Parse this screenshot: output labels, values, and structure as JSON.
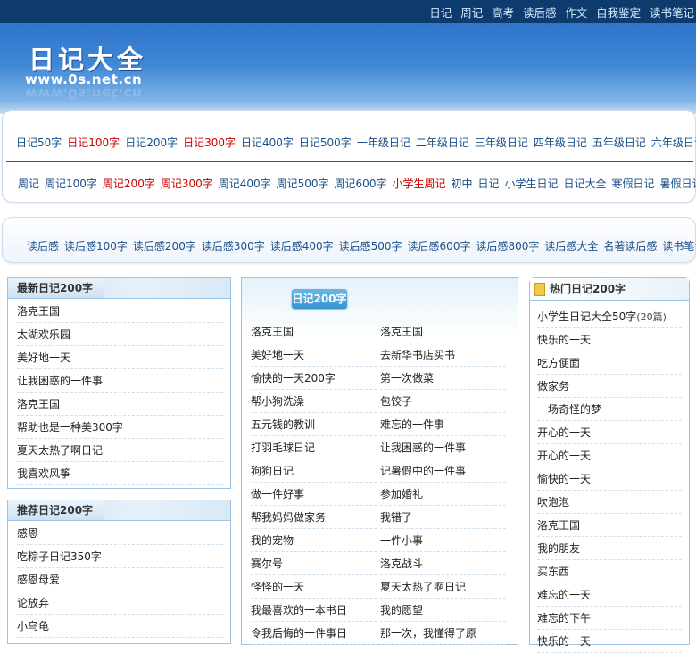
{
  "top_nav": [
    "日记",
    "周记",
    "高考",
    "读后感",
    "作文",
    "自我鉴定",
    "读书笔记"
  ],
  "logo": {
    "title": "日记大全",
    "url": "www.0s.net.cn"
  },
  "nav_row1": [
    {
      "label": "日记50字",
      "color": "blue"
    },
    {
      "label": "日记100字",
      "color": "red"
    },
    {
      "label": "日记200字",
      "color": "blue"
    },
    {
      "label": "日记300字",
      "color": "red"
    },
    {
      "label": "日记400字",
      "color": "blue"
    },
    {
      "label": "日记500字",
      "color": "blue"
    },
    {
      "label": "一年级日记",
      "color": "blue"
    },
    {
      "label": "二年级日记",
      "color": "blue"
    },
    {
      "label": "三年级日记",
      "color": "blue"
    },
    {
      "label": "四年级日记",
      "color": "blue"
    },
    {
      "label": "五年级日记",
      "color": "blue"
    },
    {
      "label": "六年级日记",
      "color": "blue"
    }
  ],
  "nav_row2": [
    {
      "label": "周记",
      "color": "blue"
    },
    {
      "label": "周记100字",
      "color": "blue"
    },
    {
      "label": "周记200字",
      "color": "red"
    },
    {
      "label": "周记300字",
      "color": "red"
    },
    {
      "label": "周记400字",
      "color": "blue"
    },
    {
      "label": "周记500字",
      "color": "blue"
    },
    {
      "label": "周记600字",
      "color": "blue"
    },
    {
      "label": "小学生周记",
      "color": "red"
    },
    {
      "label": "初中",
      "color": "blue"
    },
    {
      "label": "日记",
      "color": "blue"
    },
    {
      "label": "小学生日记",
      "color": "blue"
    },
    {
      "label": "日记大全",
      "color": "blue"
    },
    {
      "label": "寒假日记",
      "color": "blue"
    },
    {
      "label": "暑假日记",
      "color": "blue"
    }
  ],
  "nav_row3": [
    {
      "label": "读后感",
      "color": "blue"
    },
    {
      "label": "读后感100字",
      "color": "blue"
    },
    {
      "label": "读后感200字",
      "color": "blue"
    },
    {
      "label": "读后感300字",
      "color": "blue"
    },
    {
      "label": "读后感400字",
      "color": "blue"
    },
    {
      "label": "读后感500字",
      "color": "blue"
    },
    {
      "label": "读后感600字",
      "color": "blue"
    },
    {
      "label": "读后感800字",
      "color": "blue"
    },
    {
      "label": "读后感大全",
      "color": "blue"
    },
    {
      "label": "名著读后感",
      "color": "blue"
    },
    {
      "label": "读书笔记",
      "color": "blue"
    }
  ],
  "latest_box": {
    "title": "最新日记200字",
    "items": [
      "洛克王国",
      "太湖欢乐园",
      "美好地一天",
      "让我困惑的一件事",
      "洛克王国",
      "帮助也是一种美300字",
      "夏天太热了啊日记",
      "我喜欢风筝"
    ]
  },
  "recommend_box": {
    "title": "推荐日记200字",
    "items": [
      "感恩",
      "吃粽子日记350字",
      "感恩母爱",
      "论放弃",
      "小乌龟"
    ]
  },
  "middle_box": {
    "badge": "日记200字",
    "col1": [
      "洛克王国",
      "美好地一天",
      "愉快的一天200字",
      "帮小狗洗澡",
      "五元钱的教训",
      "打羽毛球日记",
      "狗狗日记",
      "做一件好事",
      "帮我妈妈做家务",
      "我的宠物",
      "赛尔号",
      "怪怪的一天",
      "我最喜欢的一本书日",
      "令我后悔的一件事日"
    ],
    "col2": [
      "洛克王国",
      "去新华书店买书",
      "第一次做菜",
      "包饺子",
      "难忘的一件事",
      "让我困惑的一件事",
      "记暑假中的一件事",
      "参加婚礼",
      "我错了",
      "一件小事",
      "洛克战斗",
      "夏天太热了啊日记",
      "我的愿望",
      "那一次，我懂得了原"
    ]
  },
  "hot_box": {
    "title": "热门日记200字",
    "first_item": "小学生日记大全50字",
    "first_count": "(20篇)",
    "items": [
      "快乐的一天",
      "吃方便面",
      "做家务",
      "一场奇怪的梦",
      "开心的一天",
      "开心的一天",
      "愉快的一天",
      "吹泡泡",
      "洛克王国",
      "我的朋友",
      "买东西",
      "难忘的一天",
      "难忘的下午",
      "快乐的一天"
    ]
  },
  "colors": {
    "topbar": "#0e3b6e",
    "link_blue": "#1a4f8a",
    "link_red": "#cc0000",
    "border": "#9cc3e4"
  }
}
